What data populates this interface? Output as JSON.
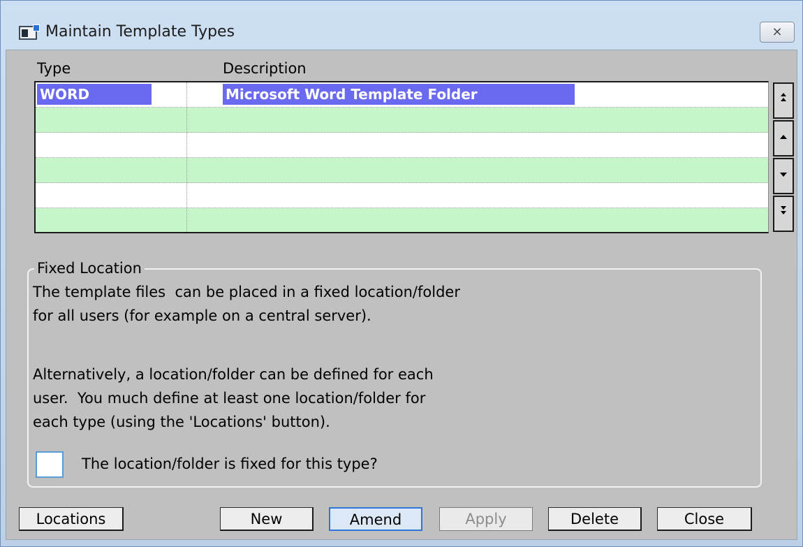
{
  "window": {
    "title": "Maintain Template Types",
    "close_glyph": "⨯"
  },
  "grid": {
    "columns": [
      "Type",
      "Description"
    ],
    "rows": [
      {
        "type": "WORD",
        "description": "Microsoft Word Template Folder",
        "selected": true
      },
      {
        "type": "",
        "description": ""
      },
      {
        "type": "",
        "description": ""
      },
      {
        "type": "",
        "description": ""
      },
      {
        "type": "",
        "description": ""
      },
      {
        "type": "",
        "description": ""
      }
    ],
    "scroll_buttons": [
      "top-icon",
      "up-icon",
      "down-icon",
      "bottom-icon"
    ]
  },
  "fixed_location": {
    "legend": "Fixed Location",
    "paragraph1_line1": "The template files  can be placed in a fixed location/folder",
    "paragraph1_line2": "for all users (for example on a central server).",
    "paragraph2_line1": "Alternatively, a location/folder can be defined for each",
    "paragraph2_line2": "user.  You much define at least one location/folder for",
    "paragraph2_line3": "each type (using the 'Locations' button).",
    "checkbox_label": "The location/folder is fixed for this type?",
    "checkbox_checked": false
  },
  "buttons": {
    "locations": "Locations",
    "new": "New",
    "amend": "Amend",
    "apply": "Apply",
    "delete": "Delete",
    "close": "Close"
  }
}
